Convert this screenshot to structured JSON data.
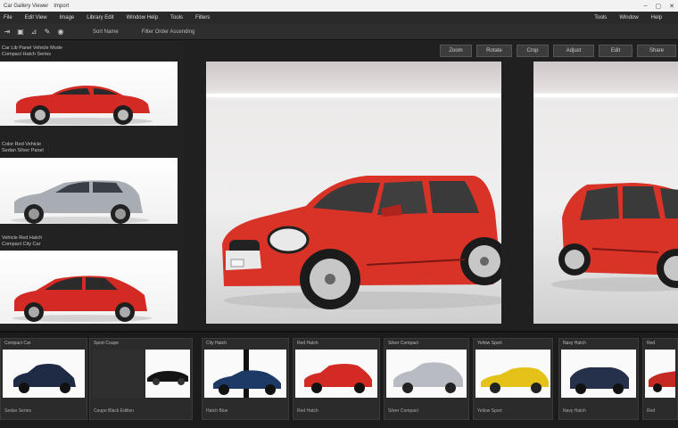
{
  "window": {
    "title": "Car Gallery Viewer",
    "menu_label": "Import"
  },
  "menubar": {
    "items": [
      "File",
      "Edit View",
      "Image",
      "Library Edit",
      "Window Help",
      "Tools",
      "Filters",
      "Tools",
      "Window",
      "Help"
    ]
  },
  "toolbar": {
    "labels": [
      "Sort Name",
      "Filter Order Ascending"
    ]
  },
  "right_tools": [
    "Zoom",
    "Rotate",
    "Crop",
    "Adjust",
    "Edit",
    "Share"
  ],
  "left_panel": {
    "captions": [
      {
        "line1": "Car Lib Panel Vehicle Mode",
        "line2": "Compact Hatch Series"
      },
      {
        "line1": "Color Red Vehicle",
        "line2": "Sedan Silver Panel"
      },
      {
        "line1": "Vehicle Red Hatch",
        "line2": "Compact City Car"
      }
    ],
    "thumbnails": [
      {
        "name": "red-coupe",
        "color": "#d42a24"
      },
      {
        "name": "silver-hatchback",
        "color": "#a8adb4"
      },
      {
        "name": "red-hatchback",
        "color": "#d42a24"
      }
    ]
  },
  "viewer": {
    "main_car_color": "#d93328",
    "secondary_car_color": "#d93328"
  },
  "filmstrip": {
    "items": [
      {
        "label": "Compact Car",
        "caption": "Sedan Series",
        "color": "#1f2a44",
        "dark": false
      },
      {
        "label": "Sport Coupe",
        "caption": "Coupe Black Edition",
        "color": "#141414",
        "dark": true
      },
      {
        "label": "City Hatch",
        "caption": "Hatch Blue",
        "color": "#1d3a66",
        "dark": false
      },
      {
        "label": "Red Hatch",
        "caption": "Red Hatch",
        "color": "#d42a24",
        "dark": false
      },
      {
        "label": "Silver Compact",
        "caption": "Silver Compact",
        "color": "#b8bcc2",
        "dark": false
      },
      {
        "label": "Yellow Sport",
        "caption": "Yellow Sport",
        "color": "#e5c21a",
        "dark": false
      },
      {
        "label": "Navy Hatch",
        "caption": "Navy Hatch",
        "color": "#25304a",
        "dark": false
      },
      {
        "label": "Red",
        "caption": "Red",
        "color": "#c42a22",
        "dark": false
      }
    ]
  }
}
